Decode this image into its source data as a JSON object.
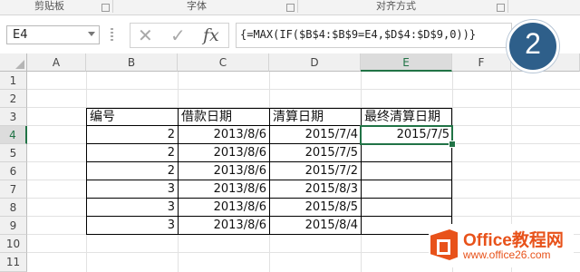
{
  "ribbon": {
    "groups": [
      "剪贴板",
      "字体",
      "对齐方式"
    ]
  },
  "formula_bar": {
    "name_box": "E4",
    "cancel_icon": "✕",
    "enter_icon": "✓",
    "fx_label": "fx",
    "formula": "{=MAX(IF($B$4:$B$9=E4,$D$4:$D$9,0))}"
  },
  "step_badge": "2",
  "columns": [
    "A",
    "B",
    "C",
    "D",
    "E",
    "F"
  ],
  "rows": [
    "1",
    "2",
    "3",
    "4",
    "5",
    "6",
    "7",
    "8",
    "9",
    "10",
    "11"
  ],
  "table": {
    "headers": [
      "编号",
      "借款日期",
      "清算日期",
      "最终清算日期"
    ],
    "rows": [
      {
        "id": "2",
        "loan": "2013/8/6",
        "settle": "2015/7/4",
        "final": "2015/7/5"
      },
      {
        "id": "2",
        "loan": "2013/8/6",
        "settle": "2015/7/5",
        "final": ""
      },
      {
        "id": "2",
        "loan": "2013/8/6",
        "settle": "2015/7/2",
        "final": ""
      },
      {
        "id": "3",
        "loan": "2013/8/6",
        "settle": "2015/8/3",
        "final": ""
      },
      {
        "id": "3",
        "loan": "2013/8/6",
        "settle": "2015/8/5",
        "final": ""
      },
      {
        "id": "3",
        "loan": "2013/8/6",
        "settle": "2015/8/4",
        "final": ""
      }
    ]
  },
  "logo": {
    "title": "Office教程网",
    "url": "www.office26.com"
  }
}
